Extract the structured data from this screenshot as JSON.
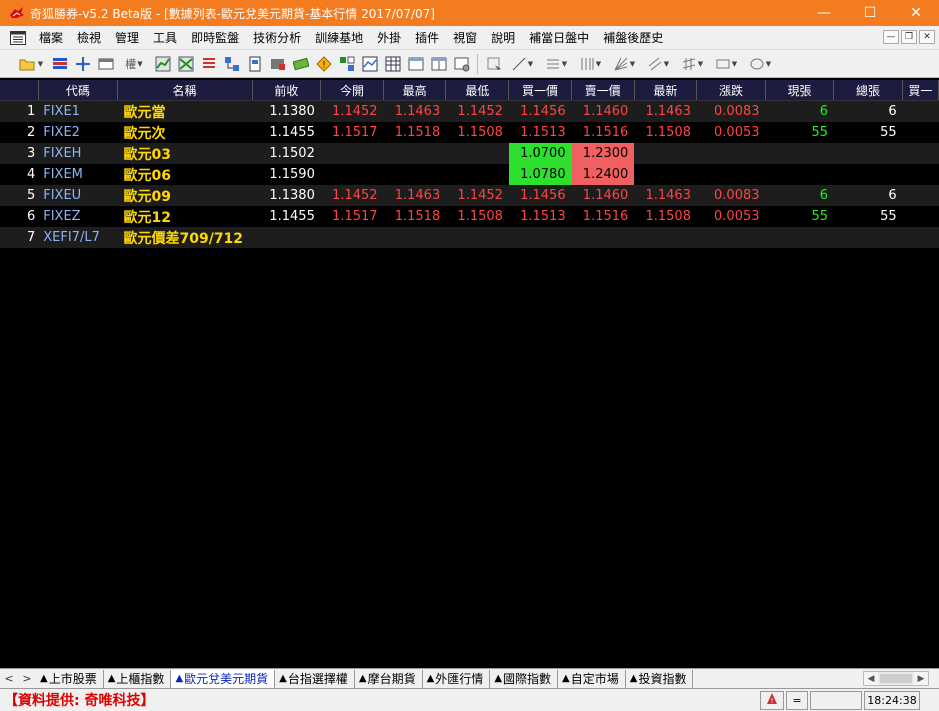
{
  "window": {
    "title": "奇狐勝券-v5.2 Beta版 - [數據列表-歐元兌美元期貨-基本行情 2017/07/07]",
    "minimize": "—",
    "maximize": "☐",
    "close": "✕"
  },
  "menu": [
    "檔案",
    "檢視",
    "管理",
    "工具",
    "即時監盤",
    "技術分析",
    "訓練基地",
    "外掛",
    "插件",
    "視窗",
    "說明",
    "補當日盤中",
    "補盤後歷史"
  ],
  "mdi_buttons": [
    "—",
    "❐",
    "✕"
  ],
  "columns": [
    "代碼",
    "名稱",
    "前收",
    "今開",
    "最高",
    "最低",
    "買一價",
    "賣一價",
    "最新",
    "漲跌",
    "現張",
    "總張",
    "買一"
  ],
  "rows": [
    {
      "idx": "1",
      "code": "FIXE1",
      "name": "歐元當",
      "prev": "1.1380",
      "open": "1.1452",
      "high": "1.1463",
      "low": "1.1452",
      "bid": "1.1456",
      "ask": "1.1460",
      "last": "1.1463",
      "chg": "0.0083",
      "vol": "6",
      "total": "6",
      "bid_hl": false,
      "ask_hl": false
    },
    {
      "idx": "2",
      "code": "FIXE2",
      "name": "歐元次",
      "prev": "1.1455",
      "open": "1.1517",
      "high": "1.1518",
      "low": "1.1508",
      "bid": "1.1513",
      "ask": "1.1516",
      "last": "1.1508",
      "chg": "0.0053",
      "vol": "55",
      "total": "55",
      "bid_hl": false,
      "ask_hl": false
    },
    {
      "idx": "3",
      "code": "FIXEH",
      "name": "歐元03",
      "prev": "1.1502",
      "open": "",
      "high": "",
      "low": "",
      "bid": "1.0700",
      "ask": "1.2300",
      "last": "",
      "chg": "",
      "vol": "",
      "total": "",
      "bid_hl": true,
      "ask_hl": true
    },
    {
      "idx": "4",
      "code": "FIXEM",
      "name": "歐元06",
      "prev": "1.1590",
      "open": "",
      "high": "",
      "low": "",
      "bid": "1.0780",
      "ask": "1.2400",
      "last": "",
      "chg": "",
      "vol": "",
      "total": "",
      "bid_hl": true,
      "ask_hl": true
    },
    {
      "idx": "5",
      "code": "FIXEU",
      "name": "歐元09",
      "prev": "1.1380",
      "open": "1.1452",
      "high": "1.1463",
      "low": "1.1452",
      "bid": "1.1456",
      "ask": "1.1460",
      "last": "1.1463",
      "chg": "0.0083",
      "vol": "6",
      "total": "6",
      "bid_hl": false,
      "ask_hl": false
    },
    {
      "idx": "6",
      "code": "FIXEZ",
      "name": "歐元12",
      "prev": "1.1455",
      "open": "1.1517",
      "high": "1.1518",
      "low": "1.1508",
      "bid": "1.1513",
      "ask": "1.1516",
      "last": "1.1508",
      "chg": "0.0053",
      "vol": "55",
      "total": "55",
      "bid_hl": false,
      "ask_hl": false
    },
    {
      "idx": "7",
      "code": "XEFI7/L7",
      "name": "歐元價差709/712",
      "prev": "",
      "open": "",
      "high": "",
      "low": "",
      "bid": "",
      "ask": "",
      "last": "",
      "chg": "",
      "vol": "",
      "total": "",
      "bid_hl": false,
      "ask_hl": false
    }
  ],
  "tab_nav": [
    "<",
    ">"
  ],
  "tabs": [
    {
      "label": "上市股票",
      "active": false
    },
    {
      "label": "上櫃指數",
      "active": false
    },
    {
      "label": "歐元兌美元期貨",
      "active": true
    },
    {
      "label": "台指選擇權",
      "active": false
    },
    {
      "label": "摩台期貨",
      "active": false
    },
    {
      "label": "外匯行情",
      "active": false
    },
    {
      "label": "國際指數",
      "active": false
    },
    {
      "label": "自定市場",
      "active": false
    },
    {
      "label": "投資指數",
      "active": false
    }
  ],
  "status": {
    "provider": "【資料提供: 奇唯科技】",
    "indicator": "=",
    "time": "18:24:38"
  },
  "colors": {
    "titlebar": "#f47c20",
    "header_bg": "#1c1c40",
    "code": "#8cb4f0",
    "name": "#ffd800",
    "up": "#ff4444",
    "volume": "#22ee22",
    "bid_highlight": "#2ee02e",
    "ask_highlight": "#f06060"
  }
}
